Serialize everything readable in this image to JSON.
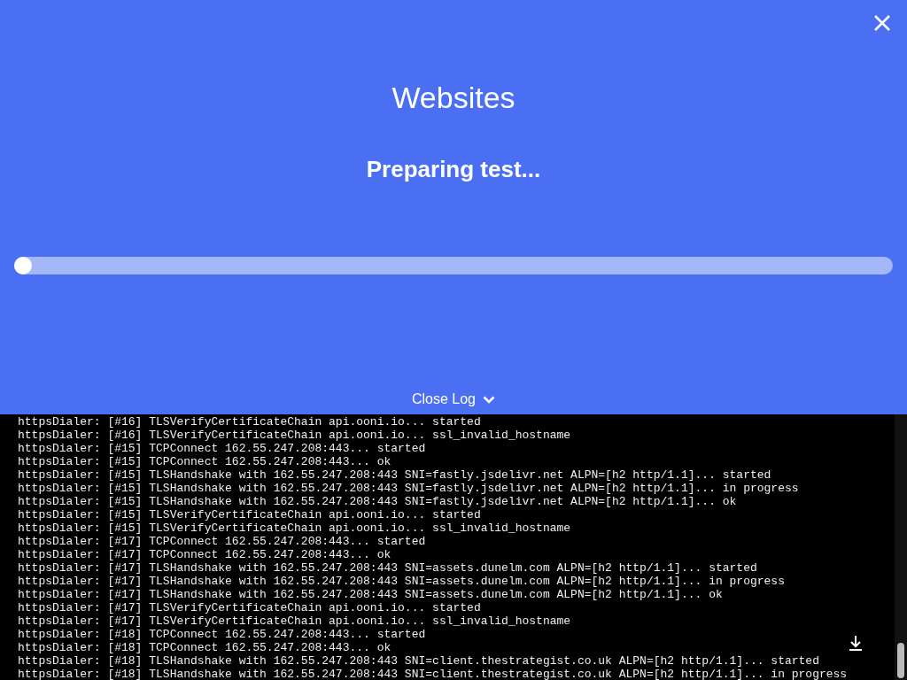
{
  "header": {
    "title": "Websites",
    "status": "Preparing test...",
    "progress": {
      "level": 0
    },
    "log_toggle": "Close Log"
  },
  "log": {
    "lines": [
      "httpsDialer: [#16] TLSVerifyCertificateChain api.ooni.io... started",
      "httpsDialer: [#16] TLSVerifyCertificateChain api.ooni.io... ssl_invalid_hostname",
      "httpsDialer: [#15] TCPConnect 162.55.247.208:443... started",
      "httpsDialer: [#15] TCPConnect 162.55.247.208:443... ok",
      "httpsDialer: [#15] TLSHandshake with 162.55.247.208:443 SNI=fastly.jsdelivr.net ALPN=[h2 http/1.1]... started",
      "httpsDialer: [#15] TLSHandshake with 162.55.247.208:443 SNI=fastly.jsdelivr.net ALPN=[h2 http/1.1]... in progress",
      "httpsDialer: [#15] TLSHandshake with 162.55.247.208:443 SNI=fastly.jsdelivr.net ALPN=[h2 http/1.1]... ok",
      "httpsDialer: [#15] TLSVerifyCertificateChain api.ooni.io... started",
      "httpsDialer: [#15] TLSVerifyCertificateChain api.ooni.io... ssl_invalid_hostname",
      "httpsDialer: [#17] TCPConnect 162.55.247.208:443... started",
      "httpsDialer: [#17] TCPConnect 162.55.247.208:443... ok",
      "httpsDialer: [#17] TLSHandshake with 162.55.247.208:443 SNI=assets.dunelm.com ALPN=[h2 http/1.1]... started",
      "httpsDialer: [#17] TLSHandshake with 162.55.247.208:443 SNI=assets.dunelm.com ALPN=[h2 http/1.1]... in progress",
      "httpsDialer: [#17] TLSHandshake with 162.55.247.208:443 SNI=assets.dunelm.com ALPN=[h2 http/1.1]... ok",
      "httpsDialer: [#17] TLSVerifyCertificateChain api.ooni.io... started",
      "httpsDialer: [#17] TLSVerifyCertificateChain api.ooni.io... ssl_invalid_hostname",
      "httpsDialer: [#18] TCPConnect 162.55.247.208:443... started",
      "httpsDialer: [#18] TCPConnect 162.55.247.208:443... ok",
      "httpsDialer: [#18] TLSHandshake with 162.55.247.208:443 SNI=client.thestrategist.co.uk ALPN=[h2 http/1.1]... started",
      "httpsDialer: [#18] TLSHandshake with 162.55.247.208:443 SNI=client.thestrategist.co.uk ALPN=[h2 http/1.1]... in progress"
    ]
  }
}
